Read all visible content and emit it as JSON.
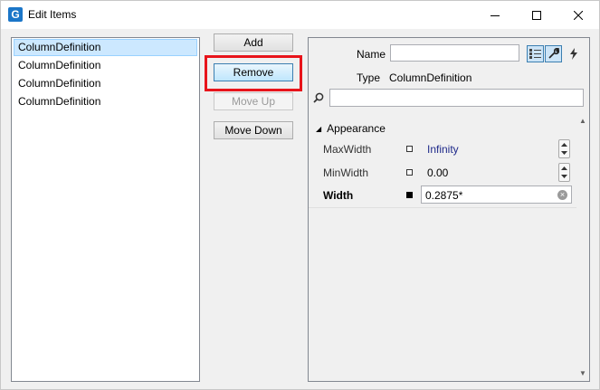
{
  "window": {
    "title": "Edit Items",
    "app_icon_letter": "G"
  },
  "items": [
    "ColumnDefinition",
    "ColumnDefinition",
    "ColumnDefinition",
    "ColumnDefinition"
  ],
  "buttons": {
    "add": "Add",
    "remove": "Remove",
    "move_up": "Move Up",
    "move_down": "Move Down"
  },
  "properties": {
    "name_label": "Name",
    "name_value": "",
    "type_label": "Type",
    "type_value": "ColumnDefinition",
    "search_value": "",
    "category": "Appearance",
    "rows": [
      {
        "name": "MaxWidth",
        "value": "Infinity"
      },
      {
        "name": "MinWidth",
        "value": "0.00"
      },
      {
        "name": "Width",
        "value": "0.2875*"
      }
    ]
  },
  "colors": {
    "highlight": "#e8141b",
    "selection": "#cce8ff",
    "infinity_text": "#1f2a8a"
  }
}
